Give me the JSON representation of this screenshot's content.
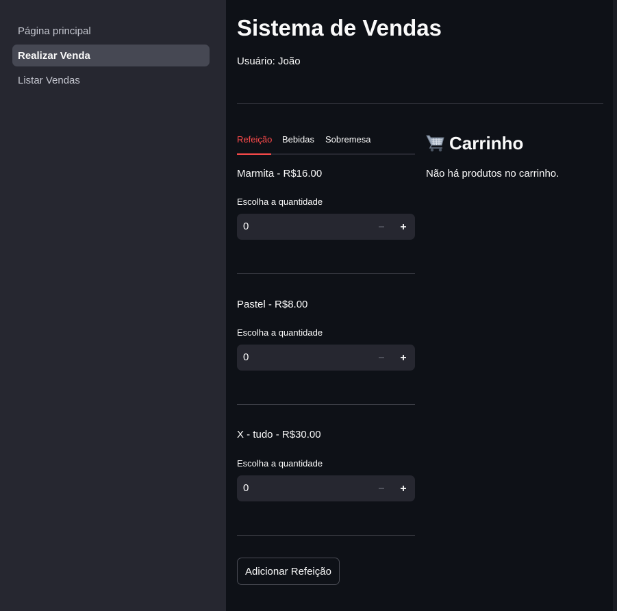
{
  "sidebar": {
    "items": [
      {
        "label": "Página principal"
      },
      {
        "label": "Realizar Venda"
      },
      {
        "label": "Listar Vendas"
      }
    ]
  },
  "header": {
    "title": "Sistema de Vendas",
    "user": "Usuário: João"
  },
  "tabs": [
    {
      "label": "Refeição"
    },
    {
      "label": "Bebidas"
    },
    {
      "label": "Sobremesa"
    }
  ],
  "products": [
    {
      "name": "Marmita - R$16.00",
      "qty_label": "Escolha a quantidade",
      "qty": "0"
    },
    {
      "name": "Pastel - R$8.00",
      "qty_label": "Escolha a quantidade",
      "qty": "0"
    },
    {
      "name": "X - tudo - R$30.00",
      "qty_label": "Escolha a quantidade",
      "qty": "0"
    }
  ],
  "submit_label": "Adicionar Refeição",
  "cart": {
    "title": "Carrinho",
    "empty_message": "Não há produtos no carrinho."
  },
  "colors": {
    "accent": "#ff4b4b",
    "background": "#0e1117",
    "sidebar": "#262730"
  },
  "icons": {
    "cart": "shopping-cart-icon",
    "minus": "minus-icon",
    "plus": "plus-icon"
  }
}
